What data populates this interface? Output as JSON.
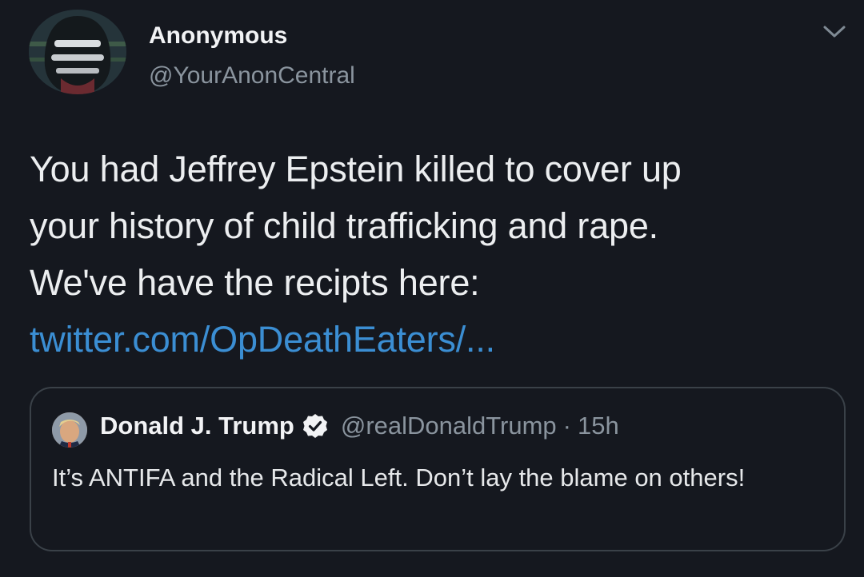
{
  "tweet": {
    "display_name": "Anonymous",
    "handle": "@YourAnonCentral",
    "text_lines": [
      "You had Jeffrey Epstein killed to cover up",
      "your history of child trafficking and rape.",
      "We've have the recipts here:"
    ],
    "link": "twitter.com/OpDeathEaters/...",
    "menu_icon": "chevron-down-icon",
    "avatar_icon": "anonymous-mask-avatar"
  },
  "quoted_tweet": {
    "display_name": "Donald J. Trump",
    "verified_icon": "verified-badge-icon",
    "handle": "@realDonaldTrump",
    "separator": "·",
    "time": "15h",
    "text": "It’s ANTIFA and the Radical Left. Don’t lay the blame on others!"
  },
  "colors": {
    "background": "#15181f",
    "link": "#3b8ed3",
    "muted": "#8a949e",
    "border": "#3a4148"
  }
}
